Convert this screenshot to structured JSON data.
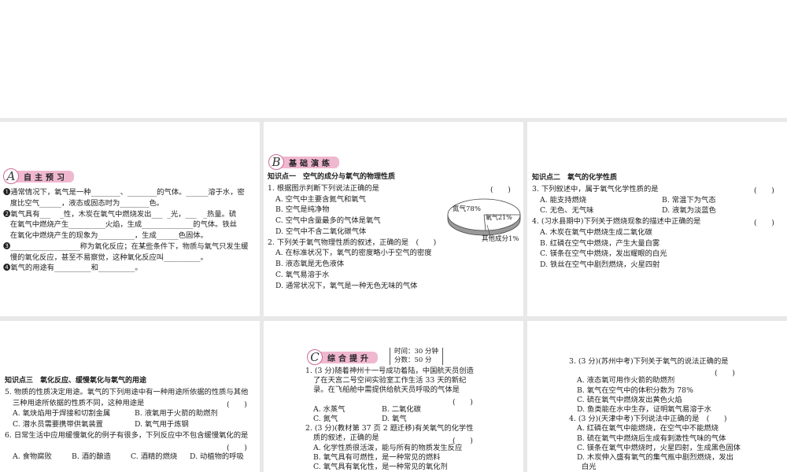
{
  "sectionA": {
    "letter": "A",
    "title": "自主预习",
    "lines": [
      "❶通常情况下，氧气是一种________、________的气体。______溶于水，密",
      "   度比空气______，液态或固态时为________色。",
      "❷氧气具有___    _性，木炭在氧气中燃烧发出___  _光，___   _热量。硫",
      "   在氧气中燃烧产生__________火焰，生成______________的气体。铁丝",
      "   在氧化中燃烧产生的现象为__________，生成______色固体。",
      "❸___________________称为氧化反应；在某些条件下，物质与氧气只发生缓",
      "   慢的氧化反应，甚至不易察觉，这种氧化反应叫__________。",
      "❹氧气的用途有__________和__________。"
    ]
  },
  "sectionB": {
    "letter": "B",
    "title": "基础演练",
    "kp1": "知识点一　空气的成分与氧气的物理性质",
    "q1": {
      "stem": "1. 根据图示判断下列说法正确的是",
      "paren": "(　　)",
      "options": [
        "A. 空气中主要含氮气和氧气",
        "B. 空气是纯净物",
        "C. 空气中含量最多的气体是氧气",
        "D. 空气中不含二氧化碳气体"
      ]
    },
    "q2": {
      "stem": "2. 下列关于氧气物理性质的叙述，正确的是　(　　)",
      "options": [
        "A. 在标准状况下，氧气的密度略小于空气的密度",
        "B. 液态氧是无色液体",
        "C. 氧气易溶于水",
        "D. 通常状况下，氧气是一种无色无味的气体"
      ]
    },
    "pie": {
      "n2": "氮气78%",
      "o2": "氧气21%",
      "other": "其他成分1%"
    },
    "kp2": "知识点二　氧气的化学性质",
    "q3": {
      "stem": "3. 下列叙述中，属于氧气化学性质的是",
      "paren": "(　　)",
      "options": [
        "A. 能支持燃烧",
        "B. 常温下为气态",
        "C. 无色、无气味",
        "D. 液氧为淡蓝色"
      ]
    },
    "q4": {
      "stem": "4. (习水县期中)下列关于燃烧现象的描述中正确的是",
      "paren": "(　　)",
      "options": [
        "A. 木炭在氧气中燃烧生成二氧化碳",
        "B. 红磷在空气中燃烧，产生大量白雾",
        "C. 镁条在空气中燃烧，发出耀眼的白光",
        "D. 铁丝在空气中剧烈燃烧，火星四射"
      ]
    },
    "kp3": "知识点三　氧化反应、缓慢氧化与氧气的用途",
    "q5": {
      "stem1": "5. 物质的性质决定用途。氧气的下列用途中有一种用途所依据的性质与其他",
      "stem2": "三种用途所依据的性质不同，这种用途是",
      "paren": "(　　)",
      "options": [
        "A. 氧炔焰用于焊接和切割金属",
        "B. 液氧用于火箭的助燃剂",
        "C. 潜水员需要携带供氧装置",
        "D. 氧气用于炼钢"
      ]
    },
    "q6": {
      "stem": "6. 日常生活中应用缓慢氧化的例子有很多，下列反应中不包含缓慢氧化的是",
      "paren": "(　　)",
      "options": [
        "A. 食物腐败",
        "B. 酒的酿造",
        "C. 酒精的燃烧",
        "D. 动植物的呼吸"
      ]
    }
  },
  "sectionC": {
    "letter": "C",
    "title": "综合提升",
    "time": "时间：30 分钟",
    "score": "分数：50 分",
    "q1": {
      "lines": [
        "1. (3 分)随着神州十一号成功着陆，中国航天员创造",
        "了在天宫二号空间实验室工作生活 33 天的新纪",
        "录。在飞船舱中需提供给航天员呼吸的气体是"
      ],
      "paren": "(　　)",
      "options": [
        "A. 水蒸气",
        "B. 二氧化碳",
        "C. 氮气",
        "D. 氧气"
      ]
    },
    "q2": {
      "lines": [
        "2. (3 分)(教材第 37 页 2 题迁移)有关氧气的化学性",
        "质的叙述，正确的是"
      ],
      "paren": "(　　)",
      "options": [
        "A. 化学性质很活泼，能与所有的物质发生反应",
        "B. 氧气具有可燃性，是一种常见的燃料",
        "C. 氧气具有氧化性，是一种常见的氧化剂"
      ]
    },
    "q3": {
      "stem": "3. (3 分)(苏州中考)下列关于氧气的说法正确的是",
      "paren": "(　　)",
      "options": [
        "A. 液态氧可用作火箭的助燃剂",
        "B. 氧气在空气中的体积分数为 78%",
        "C. 硫在氧气中燃烧发出黄色火焰",
        "D. 鱼类能在水中生存，证明氧气易溶于水"
      ]
    },
    "q4": {
      "stem": "4. (3 分)(天津中考)下列说法中正确的是　(　　)",
      "options": [
        "A. 红磷在氧气中能燃烧，在空气中不能燃烧",
        "B. 硫在氧气中燃烧后生成有刺激性气味的气体",
        "C. 镁条在氧气中燃烧时，火星四射，生成黑色固体",
        "D. 木炭伸入盛有氧气的集气瓶中剧烈燃烧，发出",
        "白光"
      ]
    }
  }
}
